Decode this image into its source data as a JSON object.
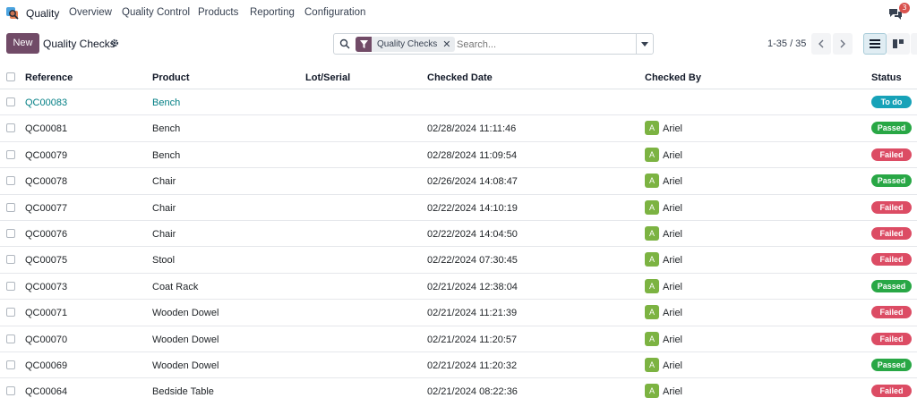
{
  "navbar": {
    "brand": "Quality",
    "menu": [
      "Overview",
      "Quality Control",
      "Products",
      "Reporting",
      "Configuration"
    ],
    "chat_count": "3"
  },
  "control": {
    "new_label": "New",
    "title": "Quality Checks",
    "facet_label": "Quality Checks",
    "search_placeholder": "Search...",
    "pager": "1-35 / 35"
  },
  "table": {
    "headers": {
      "reference": "Reference",
      "product": "Product",
      "lot": "Lot/Serial",
      "date": "Checked Date",
      "checked_by": "Checked By",
      "status": "Status"
    },
    "rows": [
      {
        "ref": "QC00083",
        "product": "Bench",
        "lot": "",
        "date": "",
        "checked_by": "",
        "avatar": "",
        "status": "To do"
      },
      {
        "ref": "QC00081",
        "product": "Bench",
        "lot": "",
        "date": "02/28/2024 11:11:46",
        "checked_by": "Ariel",
        "avatar": "A",
        "status": "Passed"
      },
      {
        "ref": "QC00079",
        "product": "Bench",
        "lot": "",
        "date": "02/28/2024 11:09:54",
        "checked_by": "Ariel",
        "avatar": "A",
        "status": "Failed"
      },
      {
        "ref": "QC00078",
        "product": "Chair",
        "lot": "",
        "date": "02/26/2024 14:08:47",
        "checked_by": "Ariel",
        "avatar": "A",
        "status": "Passed"
      },
      {
        "ref": "QC00077",
        "product": "Chair",
        "lot": "",
        "date": "02/22/2024 14:10:19",
        "checked_by": "Ariel",
        "avatar": "A",
        "status": "Failed"
      },
      {
        "ref": "QC00076",
        "product": "Chair",
        "lot": "",
        "date": "02/22/2024 14:04:50",
        "checked_by": "Ariel",
        "avatar": "A",
        "status": "Failed"
      },
      {
        "ref": "QC00075",
        "product": "Stool",
        "lot": "",
        "date": "02/22/2024 07:30:45",
        "checked_by": "Ariel",
        "avatar": "A",
        "status": "Failed"
      },
      {
        "ref": "QC00073",
        "product": "Coat Rack",
        "lot": "",
        "date": "02/21/2024 12:38:04",
        "checked_by": "Ariel",
        "avatar": "A",
        "status": "Passed"
      },
      {
        "ref": "QC00071",
        "product": "Wooden Dowel",
        "lot": "",
        "date": "02/21/2024 11:21:39",
        "checked_by": "Ariel",
        "avatar": "A",
        "status": "Failed"
      },
      {
        "ref": "QC00070",
        "product": "Wooden Dowel",
        "lot": "",
        "date": "02/21/2024 11:20:57",
        "checked_by": "Ariel",
        "avatar": "A",
        "status": "Failed"
      },
      {
        "ref": "QC00069",
        "product": "Wooden Dowel",
        "lot": "",
        "date": "02/21/2024 11:20:32",
        "checked_by": "Ariel",
        "avatar": "A",
        "status": "Passed"
      },
      {
        "ref": "QC00064",
        "product": "Bedside Table",
        "lot": "",
        "date": "02/21/2024 08:22:36",
        "checked_by": "Ariel",
        "avatar": "A",
        "status": "Failed"
      }
    ]
  },
  "colors": {
    "brand": "#714B67",
    "link": "#017e84",
    "passed": "#28a745",
    "failed": "#dc4c64",
    "todo": "#17a2b8",
    "avatar": "#7cb342"
  }
}
